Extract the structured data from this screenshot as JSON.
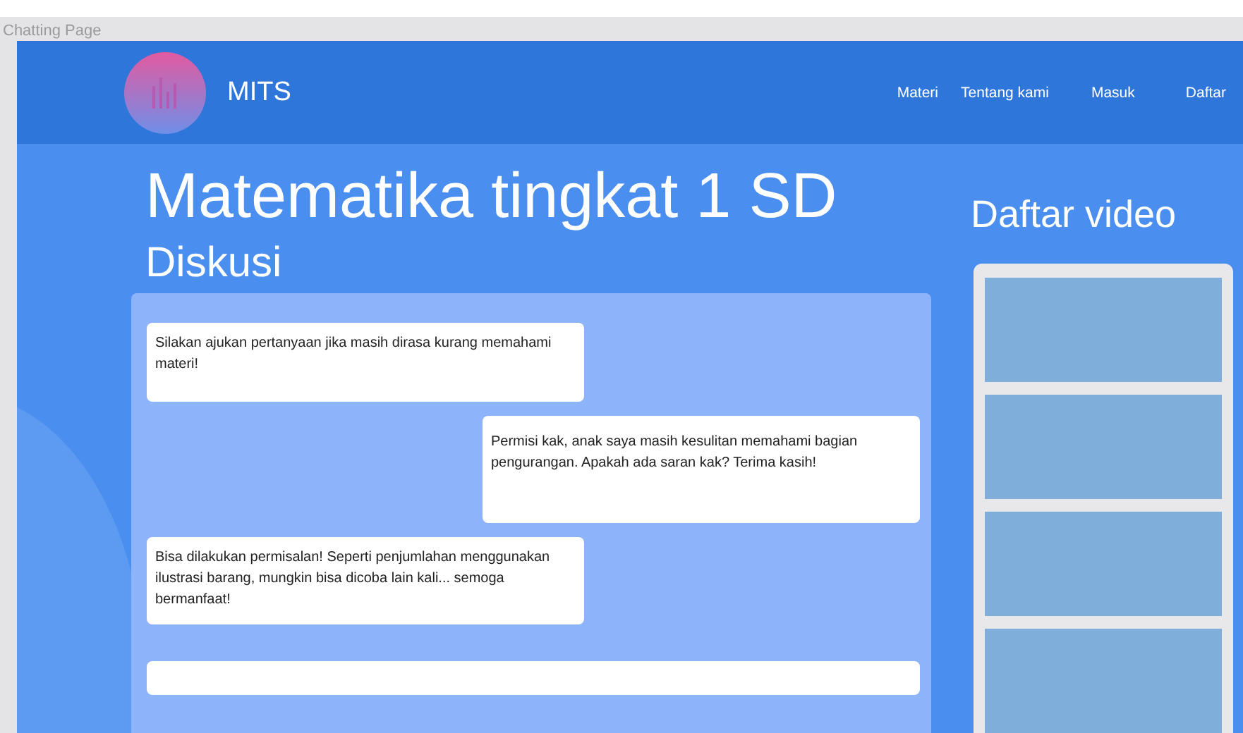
{
  "frame": {
    "label": "Chatting Page"
  },
  "header": {
    "logo_text": "MITS",
    "nav": [
      "Materi",
      "Tentang kami",
      "Masuk",
      "Daftar"
    ]
  },
  "title": "Matematika tingkat 1 SD",
  "discussion": {
    "heading": "Diskusi",
    "messages": [
      {
        "kind": "received",
        "text": "Silakan ajukan pertanyaan jika masih dirasa kurang memahami materi!"
      },
      {
        "kind": "sent",
        "text": "Permisi kak, anak saya masih kesulitan memahami bagian pengurangan. Apakah ada saran kak? Terima kasih!"
      },
      {
        "kind": "received",
        "text": "Bisa dilakukan permisalan! Seperti penjumlahan menggunakan ilustrasi barang, mungkin bisa dicoba lain kali... semoga bermanfaat!"
      }
    ]
  },
  "videos": {
    "heading": "Daftar video",
    "items": [
      {
        "kind": "placeholder"
      },
      {
        "kind": "placeholder"
      },
      {
        "kind": "placeholder"
      },
      {
        "kind": "placeholder"
      }
    ]
  }
}
